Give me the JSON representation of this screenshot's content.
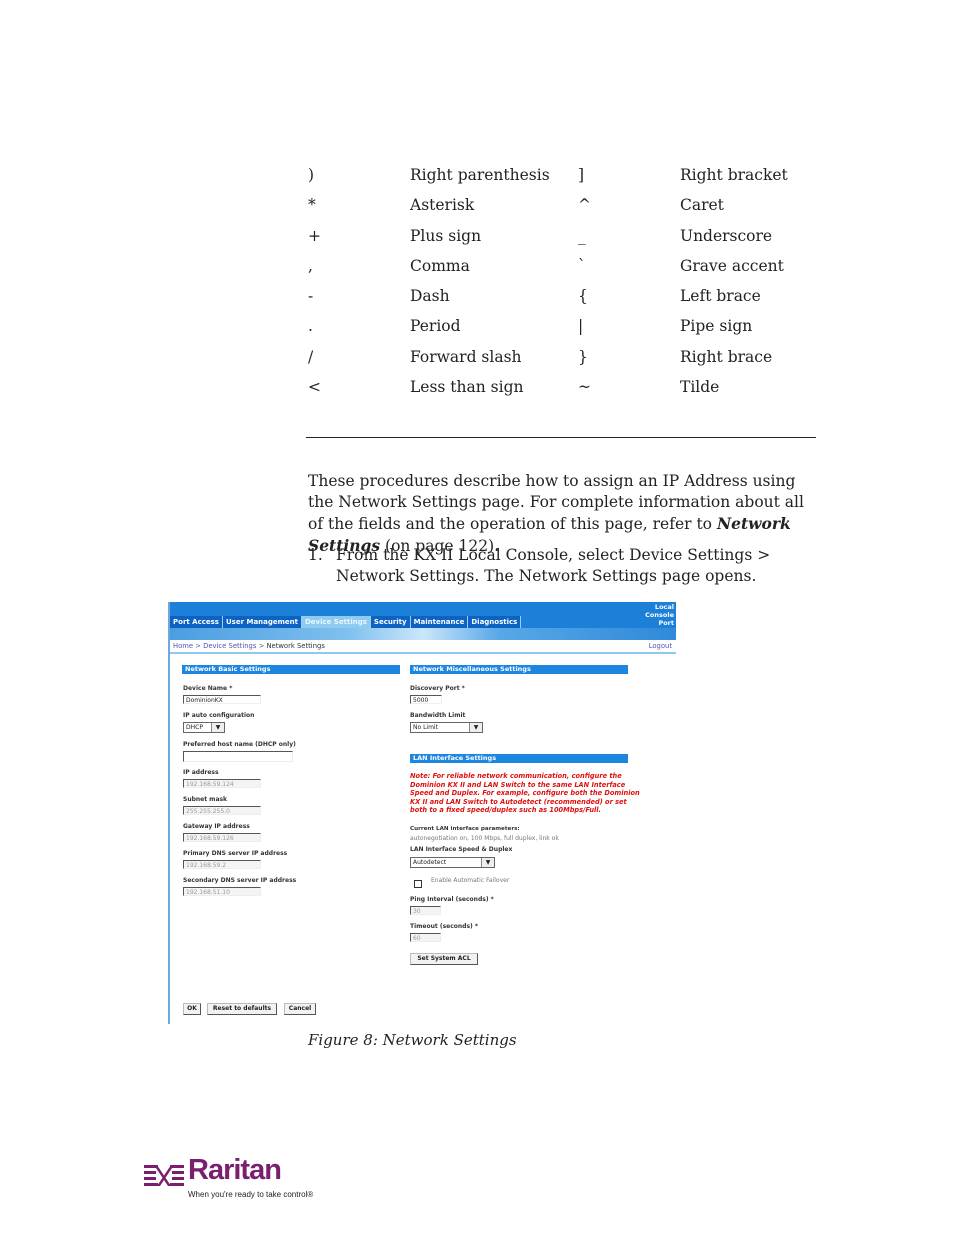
{
  "char_table": [
    {
      "sym1": ")",
      "name1": "Right parenthesis",
      "sym2": "]",
      "name2": "Right bracket"
    },
    {
      "sym1": "*",
      "name1": "Asterisk",
      "sym2": "^",
      "name2": "Caret"
    },
    {
      "sym1": "+",
      "name1": "Plus sign",
      "sym2": "_",
      "name2": "Underscore"
    },
    {
      "sym1": ",",
      "name1": "Comma",
      "sym2": "`",
      "name2": "Grave accent"
    },
    {
      "sym1": "-",
      "name1": "Dash",
      "sym2": "{",
      "name2": "Left brace"
    },
    {
      "sym1": ".",
      "name1": "Period",
      "sym2": "|",
      "name2": "Pipe sign"
    },
    {
      "sym1": "/",
      "name1": "Forward slash",
      "sym2": "}",
      "name2": "Right brace"
    },
    {
      "sym1": "<",
      "name1": "Less than sign",
      "sym2": "~",
      "name2": "Tilde"
    }
  ],
  "intro": {
    "before": "These procedures describe how to assign an IP Address using the Network Settings page. For complete information about all of the fields and the operation of this page, refer to ",
    "link": "Network Settings",
    "after": " (on page 122)."
  },
  "step1": {
    "number": "1.",
    "text": "From the KX II Local Console, select Device Settings > Network Settings. The Network Settings page opens."
  },
  "screenshot": {
    "tabs": [
      "Port Access",
      "User Management",
      "Device Settings",
      "Security",
      "Maintenance",
      "Diagnostics"
    ],
    "active_tab": "Device Settings",
    "local_console_port": [
      "Local",
      "Console",
      "Port"
    ],
    "breadcrumb": {
      "home": "Home",
      "sep": " > ",
      "section": "Device Settings",
      "current": "Network Settings"
    },
    "logout": "Logout",
    "basic": {
      "title": "Network Basic Settings",
      "device_name_label": "Device Name *",
      "device_name_value": "DominionKX",
      "ip_auto_label": "IP auto configuration",
      "ip_auto_value": "DHCP",
      "pref_host_label": "Preferred host name (DHCP only)",
      "pref_host_value": "",
      "ip_label": "IP address",
      "ip_value": "192.168.59.124",
      "subnet_label": "Subnet mask",
      "subnet_value": "255.255.255.0",
      "gateway_label": "Gateway IP address",
      "gateway_value": "192.168.59.126",
      "dns1_label": "Primary DNS server IP address",
      "dns1_value": "192.168.59.2",
      "dns2_label": "Secondary DNS server IP address",
      "dns2_value": "192.168.51.10"
    },
    "misc": {
      "title": "Network Miscellaneous Settings",
      "discovery_label": "Discovery Port *",
      "discovery_value": "5000",
      "bandwidth_label": "Bandwidth Limit",
      "bandwidth_value": "No Limit"
    },
    "lan": {
      "title": "LAN Interface Settings",
      "note": "Note: For reliable network communication, configure the Dominion KX II and LAN Switch to the same LAN Interface Speed and Duplex. For example, configure both the Dominion KX II and LAN Switch to Autodetect (recommended) or set both to a fixed speed/duplex such as 100Mbps/Full.",
      "current_label": "Current LAN interface parameters:",
      "current_value": "autonegotiation on, 100 Mbps, full duplex, link ok",
      "speed_label": "LAN Interface Speed & Duplex",
      "speed_value": "Autodetect",
      "failover_label": "Enable Automatic Failover",
      "failover_checked": false,
      "ping_label": "Ping Interval (seconds) *",
      "ping_value": "30",
      "timeout_label": "Timeout (seconds) *",
      "timeout_value": "60",
      "acl_button": "Set System ACL"
    },
    "buttons": {
      "ok": "OK",
      "reset": "Reset to defaults",
      "cancel": "Cancel"
    }
  },
  "caption": "Figure 8: Network Settings",
  "logo": {
    "brand": "Raritan",
    "tagline": "When you're ready to take control®",
    "color": "#7a1f6f"
  }
}
